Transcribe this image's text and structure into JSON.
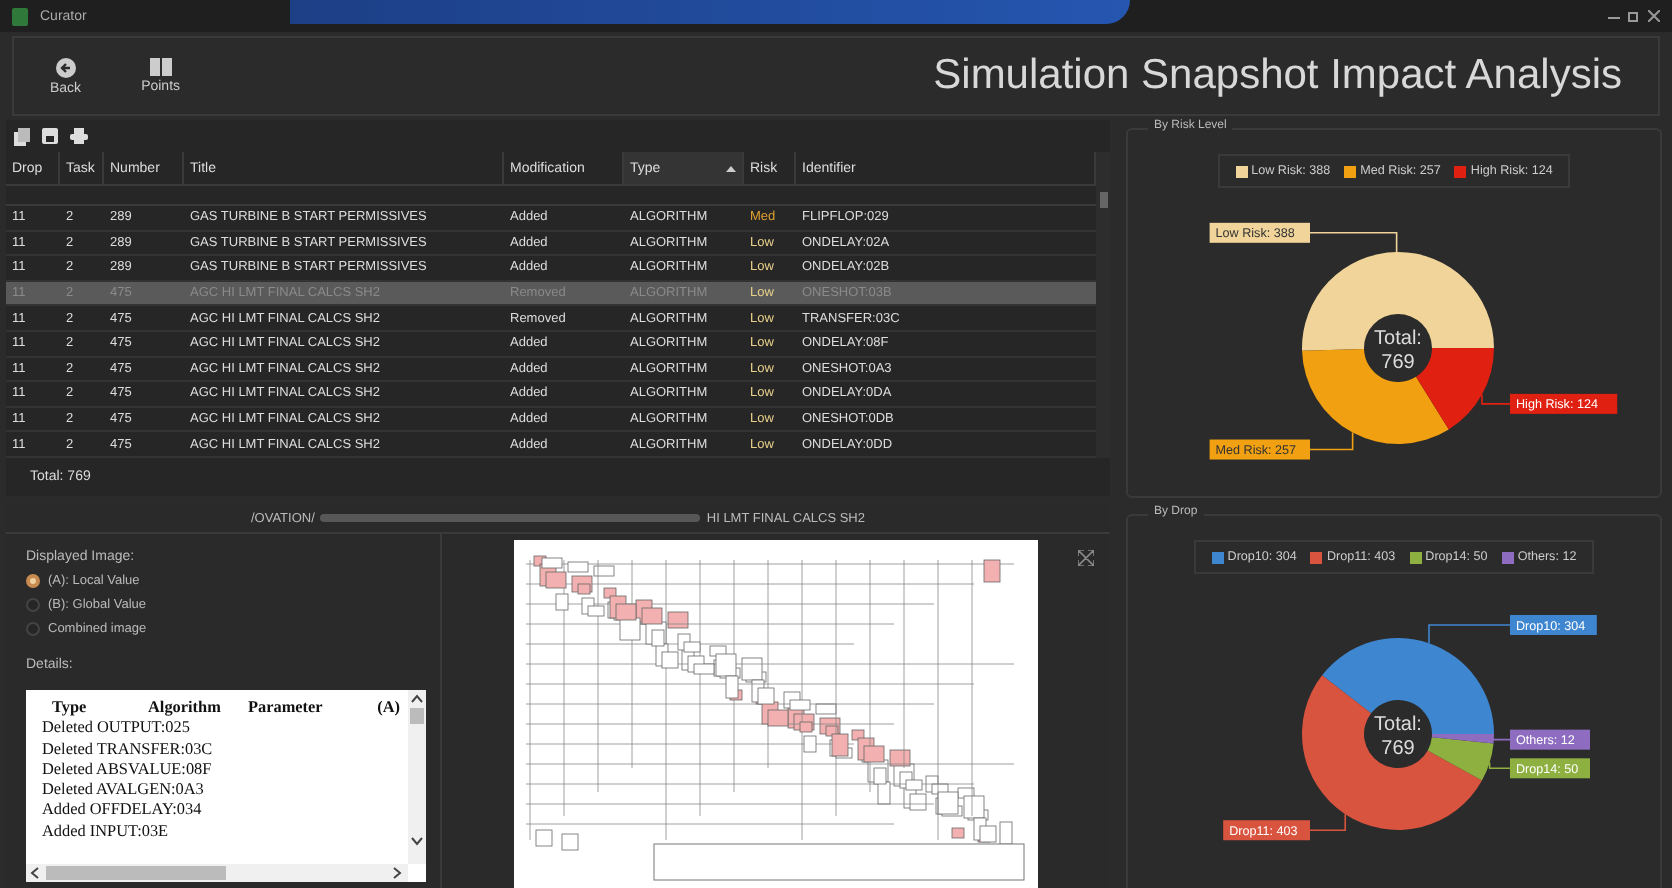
{
  "window": {
    "title": "Curator"
  },
  "toolbar": {
    "buttons": [
      {
        "label": "Back"
      },
      {
        "label": "Points"
      }
    ],
    "heading": "Simulation Snapshot Impact Analysis"
  },
  "table": {
    "columns": [
      {
        "label": "Drop",
        "sorted": false
      },
      {
        "label": "Task",
        "sorted": false
      },
      {
        "label": "Number",
        "sorted": false
      },
      {
        "label": "Title",
        "sorted": false
      },
      {
        "label": "Modification",
        "sorted": false
      },
      {
        "label": "Type",
        "sorted": true
      },
      {
        "label": "Risk",
        "sorted": false
      },
      {
        "label": "Identifier",
        "sorted": false
      }
    ],
    "rows": [
      {
        "cells": [
          "11",
          "2",
          "289",
          "GAS TURBINE B START PERMISSIVES",
          "Added",
          "ALGORITHM",
          "Med",
          "FLIPFLOP:029"
        ],
        "color": "#e0a030",
        "selected": false
      },
      {
        "cells": [
          "11",
          "2",
          "289",
          "GAS TURBINE B START PERMISSIVES",
          "Added",
          "ALGORITHM",
          "Low",
          "ONDELAY:02A"
        ],
        "color": "#e8d08a",
        "selected": false
      },
      {
        "cells": [
          "11",
          "2",
          "289",
          "GAS TURBINE B START PERMISSIVES",
          "Added",
          "ALGORITHM",
          "Low",
          "ONDELAY:02B"
        ],
        "color": "#e8d08a",
        "selected": false
      },
      {
        "cells": [
          "11",
          "2",
          "475",
          "AGC HI LMT FINAL CALCS SH2",
          "Removed",
          "ALGORITHM",
          "Low",
          "ONESHOT:03B"
        ],
        "color": "#e8d08a",
        "selected": true
      },
      {
        "cells": [
          "11",
          "2",
          "475",
          "AGC HI LMT FINAL CALCS SH2",
          "Removed",
          "ALGORITHM",
          "Low",
          "TRANSFER:03C"
        ],
        "color": "#e8d08a",
        "selected": false
      },
      {
        "cells": [
          "11",
          "2",
          "475",
          "AGC HI LMT FINAL CALCS SH2",
          "Added",
          "ALGORITHM",
          "Low",
          "ONDELAY:08F"
        ],
        "color": "#e8d08a",
        "selected": false
      },
      {
        "cells": [
          "11",
          "2",
          "475",
          "AGC HI LMT FINAL CALCS SH2",
          "Added",
          "ALGORITHM",
          "Low",
          "ONESHOT:0A3"
        ],
        "color": "#e8d08a",
        "selected": false
      },
      {
        "cells": [
          "11",
          "2",
          "475",
          "AGC HI LMT FINAL CALCS SH2",
          "Added",
          "ALGORITHM",
          "Low",
          "ONDELAY:0DA"
        ],
        "color": "#e8d08a",
        "selected": false
      },
      {
        "cells": [
          "11",
          "2",
          "475",
          "AGC HI LMT FINAL CALCS SH2",
          "Added",
          "ALGORITHM",
          "Low",
          "ONESHOT:0DB"
        ],
        "color": "#e8d08a",
        "selected": false
      },
      {
        "cells": [
          "11",
          "2",
          "475",
          "AGC HI LMT FINAL CALCS SH2",
          "Added",
          "ALGORITHM",
          "Low",
          "ONDELAY:0DD"
        ],
        "color": "#e8d08a",
        "selected": false
      }
    ],
    "total": "Total: 769"
  },
  "image_panel": {
    "path_start": "/OVATION/",
    "path_end": "HI LMT FINAL CALCS SH2"
  },
  "displayed_image": {
    "label": "Displayed Image:",
    "options": [
      {
        "label": "(A): Local Value",
        "selected": true
      },
      {
        "label": "(B): Global Value",
        "selected": false
      },
      {
        "label": "Combined image",
        "selected": false
      }
    ]
  },
  "details": {
    "label": "Details:",
    "columns": [
      "Type",
      "Algorithm",
      "Parameter",
      "(A)"
    ],
    "rows": [
      [
        "Deleted",
        "OUTPUT:025"
      ],
      [
        "Deleted",
        "TRANSFER:03C"
      ],
      [
        "Deleted",
        "ABSVALUE:08F"
      ],
      [
        "Deleted",
        "AVALGEN:0A3"
      ],
      [
        "Added",
        "OFFDELAY:034"
      ],
      [
        "Added",
        "INPUT:03E"
      ]
    ]
  },
  "risk_panel": {
    "title": "By Risk Level",
    "total_label": "Total:",
    "total": "769",
    "legend": [
      "Low Risk: 388",
      "Med Risk: 257",
      "High Risk: 124"
    ],
    "chart_data": {
      "type": "donut",
      "categories": [
        "Low Risk: 388",
        "Med Risk: 257",
        "High Risk: 124"
      ],
      "values": [
        388,
        257,
        124
      ],
      "colors": [
        "#f0d49a",
        "#f0a010",
        "#e02010"
      ]
    }
  },
  "drop_panel": {
    "title": "By Drop",
    "total_label": "Total:",
    "total": "769",
    "legend": [
      "Drop10: 304",
      "Drop11: 403",
      "Drop14: 50",
      "Others: 12"
    ],
    "chart_data": {
      "type": "donut",
      "categories": [
        "Drop10: 304",
        "Drop11: 403",
        "Drop14: 50",
        "Others: 12"
      ],
      "values": [
        304,
        403,
        50,
        12
      ],
      "colors": [
        "#3f86d0",
        "#d9543f",
        "#8db040",
        "#8e6cc0"
      ]
    }
  }
}
